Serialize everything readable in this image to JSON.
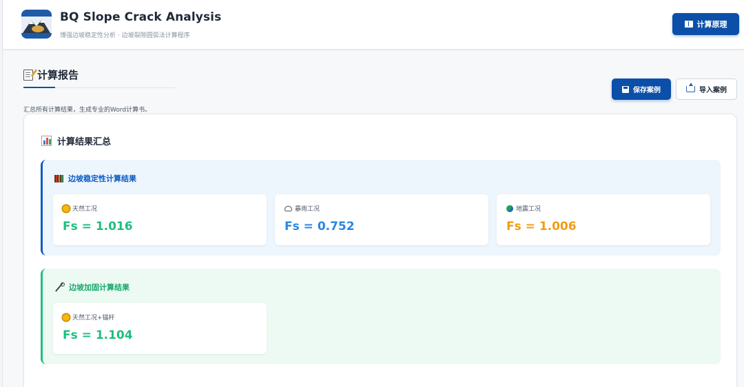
{
  "header": {
    "title": "BQ Slope Crack Analysis",
    "subtitle": "博强边坡稳定性分析 · 边坡裂隙圆弧法计算程序",
    "principle_button": "计算原理"
  },
  "report": {
    "title": "计算报告",
    "description": "汇总所有计算结果，生成专业的Word计算书。",
    "save_button": "保存案例",
    "import_button": "导入案例"
  },
  "summary": {
    "title": "计算结果汇总",
    "stability": {
      "title": "边坡稳定性计算结果",
      "results": [
        {
          "label": "天然工况",
          "value": "Fs = 1.016",
          "icon": "sun-icon",
          "color": "#1fbf7f"
        },
        {
          "label": "暴雨工况",
          "value": "Fs = 0.752",
          "icon": "rain-cloud-icon",
          "color": "#2a86e0"
        },
        {
          "label": "地震工况",
          "value": "Fs = 1.006",
          "icon": "globe-icon",
          "color": "#f29c12"
        }
      ]
    },
    "reinforcement": {
      "title": "边坡加固计算结果",
      "results": [
        {
          "label": "天然工况+锚杆",
          "value": "Fs = 1.104",
          "icon": "sun-icon",
          "color": "#1fbf7f"
        }
      ]
    }
  },
  "colors": {
    "primary": "#0b4fa8",
    "stability_accent": "#0b5bc4",
    "reinforcement_accent": "#1fbf7f"
  }
}
